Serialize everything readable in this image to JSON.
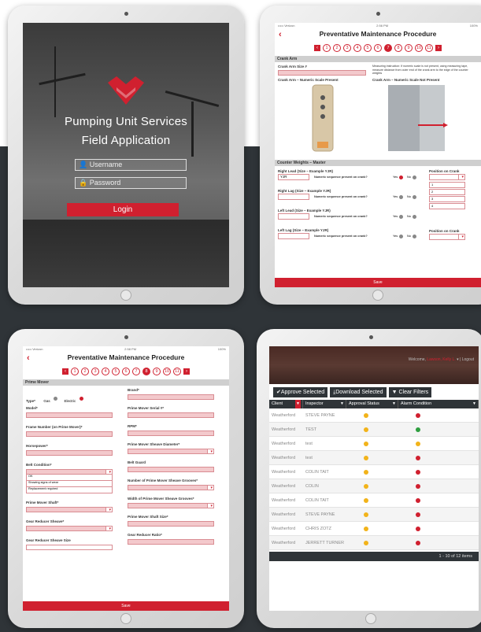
{
  "login": {
    "title_line1": "Pumping Unit Services",
    "title_line2": "Field Application",
    "username_placeholder": "Username",
    "password_placeholder": "Password",
    "login_label": "Login",
    "brand_color": "#d0202f"
  },
  "pm1": {
    "status_left": "••••• Verizon",
    "status_center": "2:56 PM",
    "status_right": "100%",
    "back_icon": "chevron-left-icon",
    "title": "Preventative Maintenance Procedure",
    "steps": [
      "1",
      "2",
      "3",
      "4",
      "5",
      "6",
      "7",
      "8",
      "9",
      "10",
      "11"
    ],
    "active_step": "7",
    "crank": {
      "section": "Crank Arm",
      "crank_size_label": "Crank Arm Size #",
      "measuring_text": "Measuring instruction: If numeric scale is not present, using measuring tape, measure distance from outer end of the crank arm to the edge of the counter weights",
      "present_label": "Crank Arm – Numeric Scale Present",
      "not_present_label": "Crank Arm – Numeric Scale Not Present"
    },
    "weights": {
      "section": "Counter Weights – Master",
      "rows": [
        {
          "label": "Right Lead (Size – Example YJR)",
          "value": "YJR",
          "question": "Numeric sequence present on crank?",
          "yes": "Yes",
          "no": "No"
        },
        {
          "label": "Right Lag (Size – Example YJR)",
          "value": "",
          "question": "Numeric sequence present on crank?",
          "yes": "Yes",
          "no": "No"
        },
        {
          "label": "Left Lead (Size – Example YJR)",
          "value": "",
          "question": "Numeric sequence present on crank?",
          "yes": "Yes",
          "no": "No"
        },
        {
          "label": "Left Lag (Size – Example YJR)",
          "value": "",
          "question": "Numeric sequence present on crank?",
          "yes": "Yes",
          "no": "No"
        }
      ],
      "position_label": "Position on Crank",
      "position_options": [
        "1",
        "2",
        "3",
        "4"
      ]
    },
    "save_label": "Save"
  },
  "pm2": {
    "status_left": "••••• Verizon",
    "status_center": "2:58 PM",
    "status_right": "100%",
    "title": "Preventative Maintenance Procedure",
    "steps": [
      "1",
      "2",
      "3",
      "4",
      "5",
      "6",
      "7",
      "8",
      "9",
      "10",
      "11"
    ],
    "active_step": "8",
    "section": "Prime Mover",
    "type_label": "Type*",
    "type_gas": "Gas",
    "type_electric": "Electric",
    "left_fields": [
      {
        "label": "Model*",
        "kind": "text"
      },
      {
        "label": "Frame Number (on Prime Mover)*",
        "kind": "text"
      },
      {
        "label": "Horsepower*",
        "kind": "text"
      },
      {
        "label": "Belt Condition*",
        "kind": "select"
      }
    ],
    "belt_options": [
      "OK",
      "Showing signs of wear",
      "Replacement required"
    ],
    "left_fields2": [
      {
        "label": "Prime Mover Shaft*",
        "kind": "select"
      },
      {
        "label": "Gear Reducer Sheave*",
        "kind": "select"
      },
      {
        "label": "Gear Reducer Sheave Size",
        "kind": "text"
      }
    ],
    "right_fields": [
      {
        "label": "Brand*",
        "kind": "text"
      },
      {
        "label": "Prime Mover Serial #*",
        "kind": "text"
      },
      {
        "label": "RPM*",
        "kind": "text"
      },
      {
        "label": "Prime Mover Sheave Diameter*",
        "kind": "select"
      },
      {
        "label": "Belt Guard",
        "kind": "text"
      },
      {
        "label": "Number of Prime Mover Sheave Grooves*",
        "kind": "select"
      },
      {
        "label": "Width of Prime Mover Sheave Grooves*",
        "kind": "select"
      },
      {
        "label": "Prime Mover Shaft Size*",
        "kind": "text"
      },
      {
        "label": "Gear Reducer Ratio*",
        "kind": "text"
      }
    ],
    "save_label": "Save"
  },
  "grid": {
    "welcome_prefix": "Welcome,",
    "welcome_name": "Lawson, Kelly L.",
    "logout": "Logout",
    "approve_label": "Approve Selected",
    "download_label": "Download Selected",
    "clear_label": "Clear Filters",
    "columns": [
      "Client",
      "Inspector",
      "Approval Status",
      "Alarm Condition"
    ],
    "rows": [
      {
        "client": "Weatherford",
        "inspector": "STEVE PAYNE",
        "approval": "#f2b31a",
        "alarm": "#d0202f"
      },
      {
        "client": "Weatherford",
        "inspector": "TEST",
        "approval": "#f2b31a",
        "alarm": "#2e9e3f"
      },
      {
        "client": "Weatherford",
        "inspector": "test",
        "approval": "#f2b31a",
        "alarm": "#f2b31a"
      },
      {
        "client": "Weatherford",
        "inspector": "test",
        "approval": "#f2b31a",
        "alarm": "#d0202f"
      },
      {
        "client": "Weatherford",
        "inspector": "COLIN TAIT",
        "approval": "#f2b31a",
        "alarm": "#d0202f"
      },
      {
        "client": "Weatherford",
        "inspector": "COLIN",
        "approval": "#f2b31a",
        "alarm": "#d0202f"
      },
      {
        "client": "Weatherford",
        "inspector": "COLIN TAIT",
        "approval": "#f2b31a",
        "alarm": "#d0202f"
      },
      {
        "client": "Weatherford",
        "inspector": "STEVE PAYNE",
        "approval": "#f2b31a",
        "alarm": "#d0202f"
      },
      {
        "client": "Weatherford",
        "inspector": "CHRIS ZOTZ",
        "approval": "#f2b31a",
        "alarm": "#d0202f"
      },
      {
        "client": "Weatherford",
        "inspector": "JERRETT TURNER",
        "approval": "#f2b31a",
        "alarm": "#d0202f"
      }
    ],
    "pager": "1 - 10 of 12 items"
  }
}
